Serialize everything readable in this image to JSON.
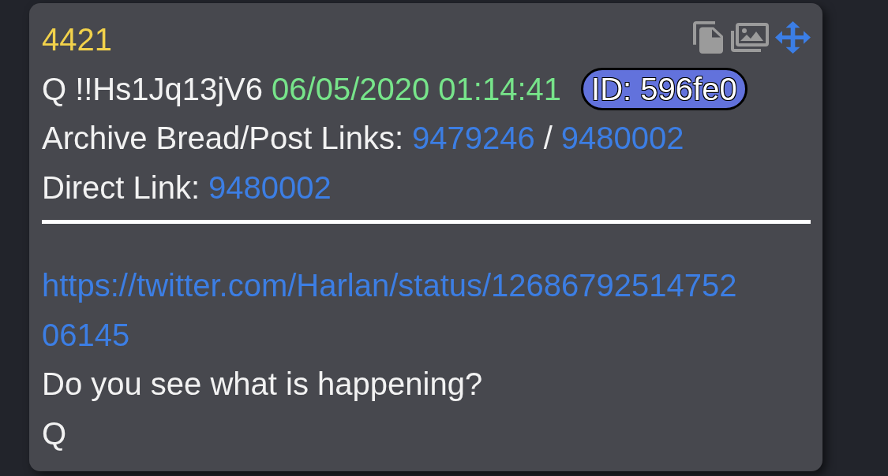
{
  "post": {
    "number": "4421",
    "name": "Q",
    "tripcode": "!!Hs1Jq13jV6",
    "timestamp": "06/05/2020 01:14:41",
    "id_badge": "ID: 596fe0",
    "archive_links": {
      "label": "Archive Bread/Post Links:",
      "bread": "9479246",
      "separator": "/",
      "post": "9480002"
    },
    "direct_link": {
      "label": "Direct Link:",
      "link": "9480002"
    },
    "body": [
      {
        "kind": "link",
        "text": "https://twitter.com/Harlan/status/1268679251475206145"
      },
      {
        "kind": "text",
        "text": "Do you see what is happening?"
      },
      {
        "kind": "text",
        "text": "Q"
      }
    ]
  }
}
